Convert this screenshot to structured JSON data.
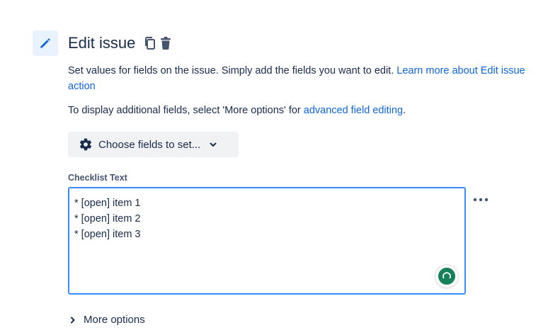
{
  "header": {
    "title": "Edit issue",
    "icons": [
      "pencil-icon",
      "copy-icon",
      "trash-icon"
    ]
  },
  "description": {
    "text": "Set values for fields on the issue. Simply add the fields you want to edit. ",
    "link": "Learn more about Edit issue action"
  },
  "advanced": {
    "text_before": "To display additional fields, select 'More options' for ",
    "link": "advanced field editing",
    "text_after": "."
  },
  "choose_fields": {
    "label": "Choose fields to set...",
    "icon": "gear-icon"
  },
  "checklist": {
    "label": "Checklist Text",
    "lines": [
      "* [open] item 1",
      "* [open] item 2",
      "* [open] item 3"
    ]
  },
  "more_options": {
    "label": "More options"
  },
  "colors": {
    "link": "#0c66e4",
    "focus_border": "#388bff",
    "icon_bg": "#e9f2ff",
    "grammar": "#15805a"
  }
}
